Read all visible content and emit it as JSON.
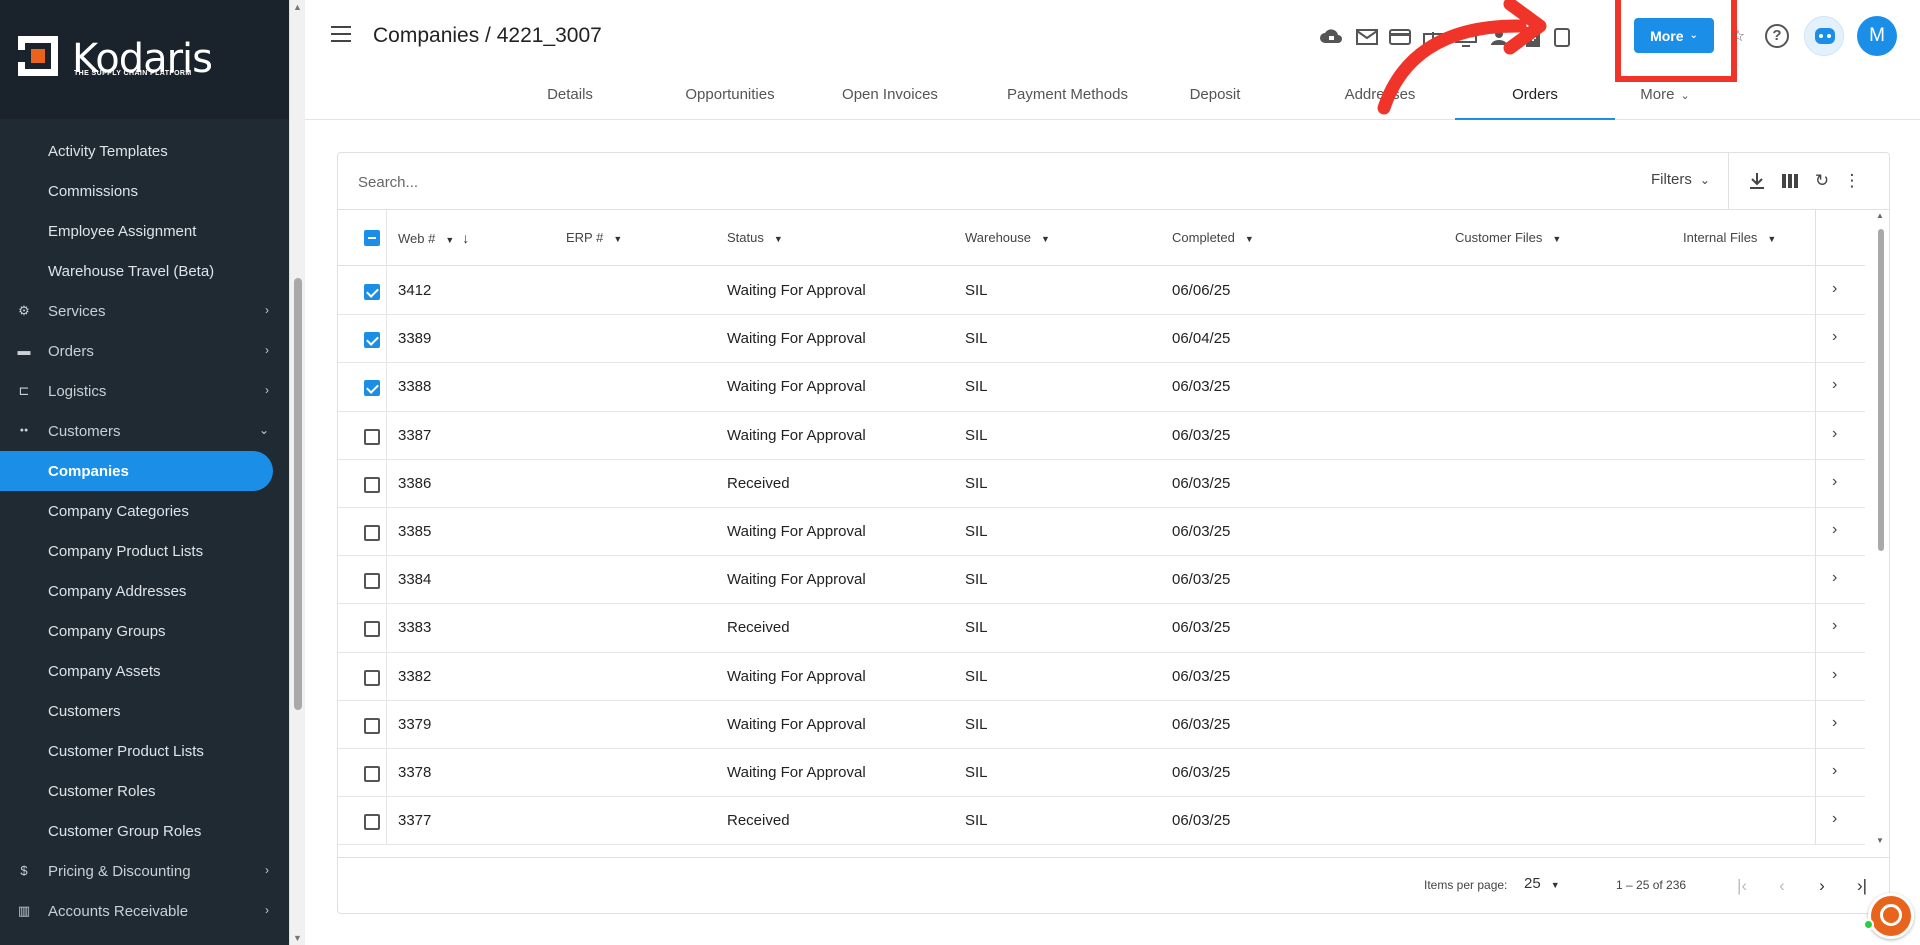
{
  "brand": {
    "name": "Kodaris",
    "tagline": "THE SUPPLY CHAIN PLATFORM"
  },
  "sidebar": {
    "items": [
      {
        "label": "Activity Templates",
        "icon": "",
        "type": "sub"
      },
      {
        "label": "Commissions",
        "icon": "",
        "type": "sub"
      },
      {
        "label": "Employee Assignment",
        "icon": "",
        "type": "sub"
      },
      {
        "label": "Warehouse Travel (Beta)",
        "icon": "",
        "type": "sub"
      },
      {
        "label": "Services",
        "icon": "gears-icon",
        "type": "group",
        "chevron": "›"
      },
      {
        "label": "Orders",
        "icon": "truck-icon",
        "type": "group",
        "chevron": "›"
      },
      {
        "label": "Logistics",
        "icon": "forklift-icon",
        "type": "group",
        "chevron": "›"
      },
      {
        "label": "Customers",
        "icon": "people-icon",
        "type": "group",
        "chevron": "⌄"
      },
      {
        "label": "Companies",
        "icon": "",
        "type": "sub",
        "active": true
      },
      {
        "label": "Company Categories",
        "icon": "",
        "type": "sub"
      },
      {
        "label": "Company Product Lists",
        "icon": "",
        "type": "sub"
      },
      {
        "label": "Company Addresses",
        "icon": "",
        "type": "sub"
      },
      {
        "label": "Company Groups",
        "icon": "",
        "type": "sub"
      },
      {
        "label": "Company Assets",
        "icon": "",
        "type": "sub"
      },
      {
        "label": "Customers",
        "icon": "",
        "type": "sub"
      },
      {
        "label": "Customer Product Lists",
        "icon": "",
        "type": "sub"
      },
      {
        "label": "Customer Roles",
        "icon": "",
        "type": "sub"
      },
      {
        "label": "Customer Group Roles",
        "icon": "",
        "type": "sub"
      },
      {
        "label": "Pricing & Discounting",
        "icon": "dollar-icon",
        "type": "group",
        "chevron": "›"
      },
      {
        "label": "Accounts Receivable",
        "icon": "bank-icon",
        "type": "group",
        "chevron": "›"
      }
    ]
  },
  "header": {
    "title": "Companies / 4221_3007",
    "more_label": "More",
    "avatar_initial": "M",
    "tabs": [
      {
        "label": "Details"
      },
      {
        "label": "Opportunities"
      },
      {
        "label": "Open Invoices"
      },
      {
        "label": "Payment Methods"
      },
      {
        "label": "Deposit"
      },
      {
        "label": "Addresses"
      },
      {
        "label": "Orders",
        "active": true
      },
      {
        "label": "More"
      }
    ]
  },
  "colors": {
    "accent": "#1b8ee8",
    "sidebar_bg": "#1f2a33",
    "annotation": "#f0342a",
    "chat": "#e8641c"
  },
  "table": {
    "search_placeholder": "Search...",
    "filters_label": "Filters",
    "columns": [
      "Web #",
      "ERP #",
      "Status",
      "Warehouse",
      "Completed",
      "Customer Files",
      "Internal Files"
    ],
    "rows": [
      {
        "checked": true,
        "web": "3412",
        "erp": "",
        "status": "Waiting For Approval",
        "warehouse": "SIL",
        "completed": "06/06/25"
      },
      {
        "checked": true,
        "web": "3389",
        "erp": "",
        "status": "Waiting For Approval",
        "warehouse": "SIL",
        "completed": "06/04/25"
      },
      {
        "checked": true,
        "web": "3388",
        "erp": "",
        "status": "Waiting For Approval",
        "warehouse": "SIL",
        "completed": "06/03/25"
      },
      {
        "checked": false,
        "web": "3387",
        "erp": "",
        "status": "Waiting For Approval",
        "warehouse": "SIL",
        "completed": "06/03/25"
      },
      {
        "checked": false,
        "web": "3386",
        "erp": "",
        "status": "Received",
        "warehouse": "SIL",
        "completed": "06/03/25"
      },
      {
        "checked": false,
        "web": "3385",
        "erp": "",
        "status": "Waiting For Approval",
        "warehouse": "SIL",
        "completed": "06/03/25"
      },
      {
        "checked": false,
        "web": "3384",
        "erp": "",
        "status": "Waiting For Approval",
        "warehouse": "SIL",
        "completed": "06/03/25"
      },
      {
        "checked": false,
        "web": "3383",
        "erp": "",
        "status": "Received",
        "warehouse": "SIL",
        "completed": "06/03/25"
      },
      {
        "checked": false,
        "web": "3382",
        "erp": "",
        "status": "Waiting For Approval",
        "warehouse": "SIL",
        "completed": "06/03/25"
      },
      {
        "checked": false,
        "web": "3379",
        "erp": "",
        "status": "Waiting For Approval",
        "warehouse": "SIL",
        "completed": "06/03/25"
      },
      {
        "checked": false,
        "web": "3378",
        "erp": "",
        "status": "Waiting For Approval",
        "warehouse": "SIL",
        "completed": "06/03/25"
      },
      {
        "checked": false,
        "web": "3377",
        "erp": "",
        "status": "Received",
        "warehouse": "SIL",
        "completed": "06/03/25"
      }
    ]
  },
  "paginator": {
    "items_per_page_label": "Items per page:",
    "items_per_page": "25",
    "range_label": "1 – 25 of 236"
  }
}
